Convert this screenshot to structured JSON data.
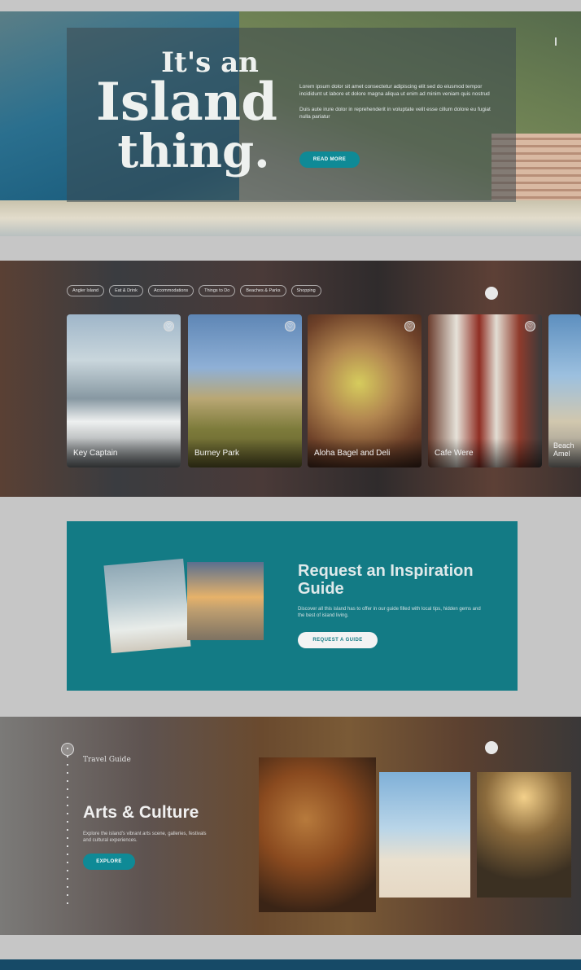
{
  "hero": {
    "title_line1": "It's an",
    "title_line2": "Island",
    "title_line3": "thing.",
    "paragraph1": "Lorem ipsum dolor sit amet consectetur adipiscing elit sed do eiusmod tempor incididunt ut labore et dolore magna aliqua ut enim ad minim veniam quis nostrud",
    "paragraph2": "Duis aute irure dolor in reprehenderit in voluptate velit esse cillum dolore eu fugiat nulla pariatur",
    "button_label": "READ MORE"
  },
  "places": {
    "chips": [
      "Angler Island",
      "Eat & Drink",
      "Accommodations",
      "Things to Do",
      "Beaches & Parks",
      "Shopping"
    ],
    "cards": [
      {
        "label": "Key Captain",
        "icon": "heart-icon"
      },
      {
        "label": "Burney Park",
        "icon": "heart-icon"
      },
      {
        "label": "Aloha Bagel and Deli",
        "icon": "heart-icon"
      },
      {
        "label": "Cafe Were",
        "icon": "heart-icon"
      },
      {
        "label": "Beach Amel",
        "icon": "heart-icon"
      }
    ]
  },
  "guide": {
    "title": "Request an Inspiration Guide",
    "text": "Discover all this island has to offer in our guide filled with local tips, hidden gems and the best of island living.",
    "button_label": "REQUEST A GUIDE"
  },
  "travel_guide": {
    "eyebrow": "Travel Guide",
    "title": "Arts & Culture",
    "text": "Explore the island's vibrant arts scene, galleries, festivals and cultural experiences.",
    "button_label": "EXPLORE"
  },
  "colors": {
    "accent_teal": "#137b85",
    "button_teal": "#0f8a96",
    "footer_navy": "#164a67"
  }
}
